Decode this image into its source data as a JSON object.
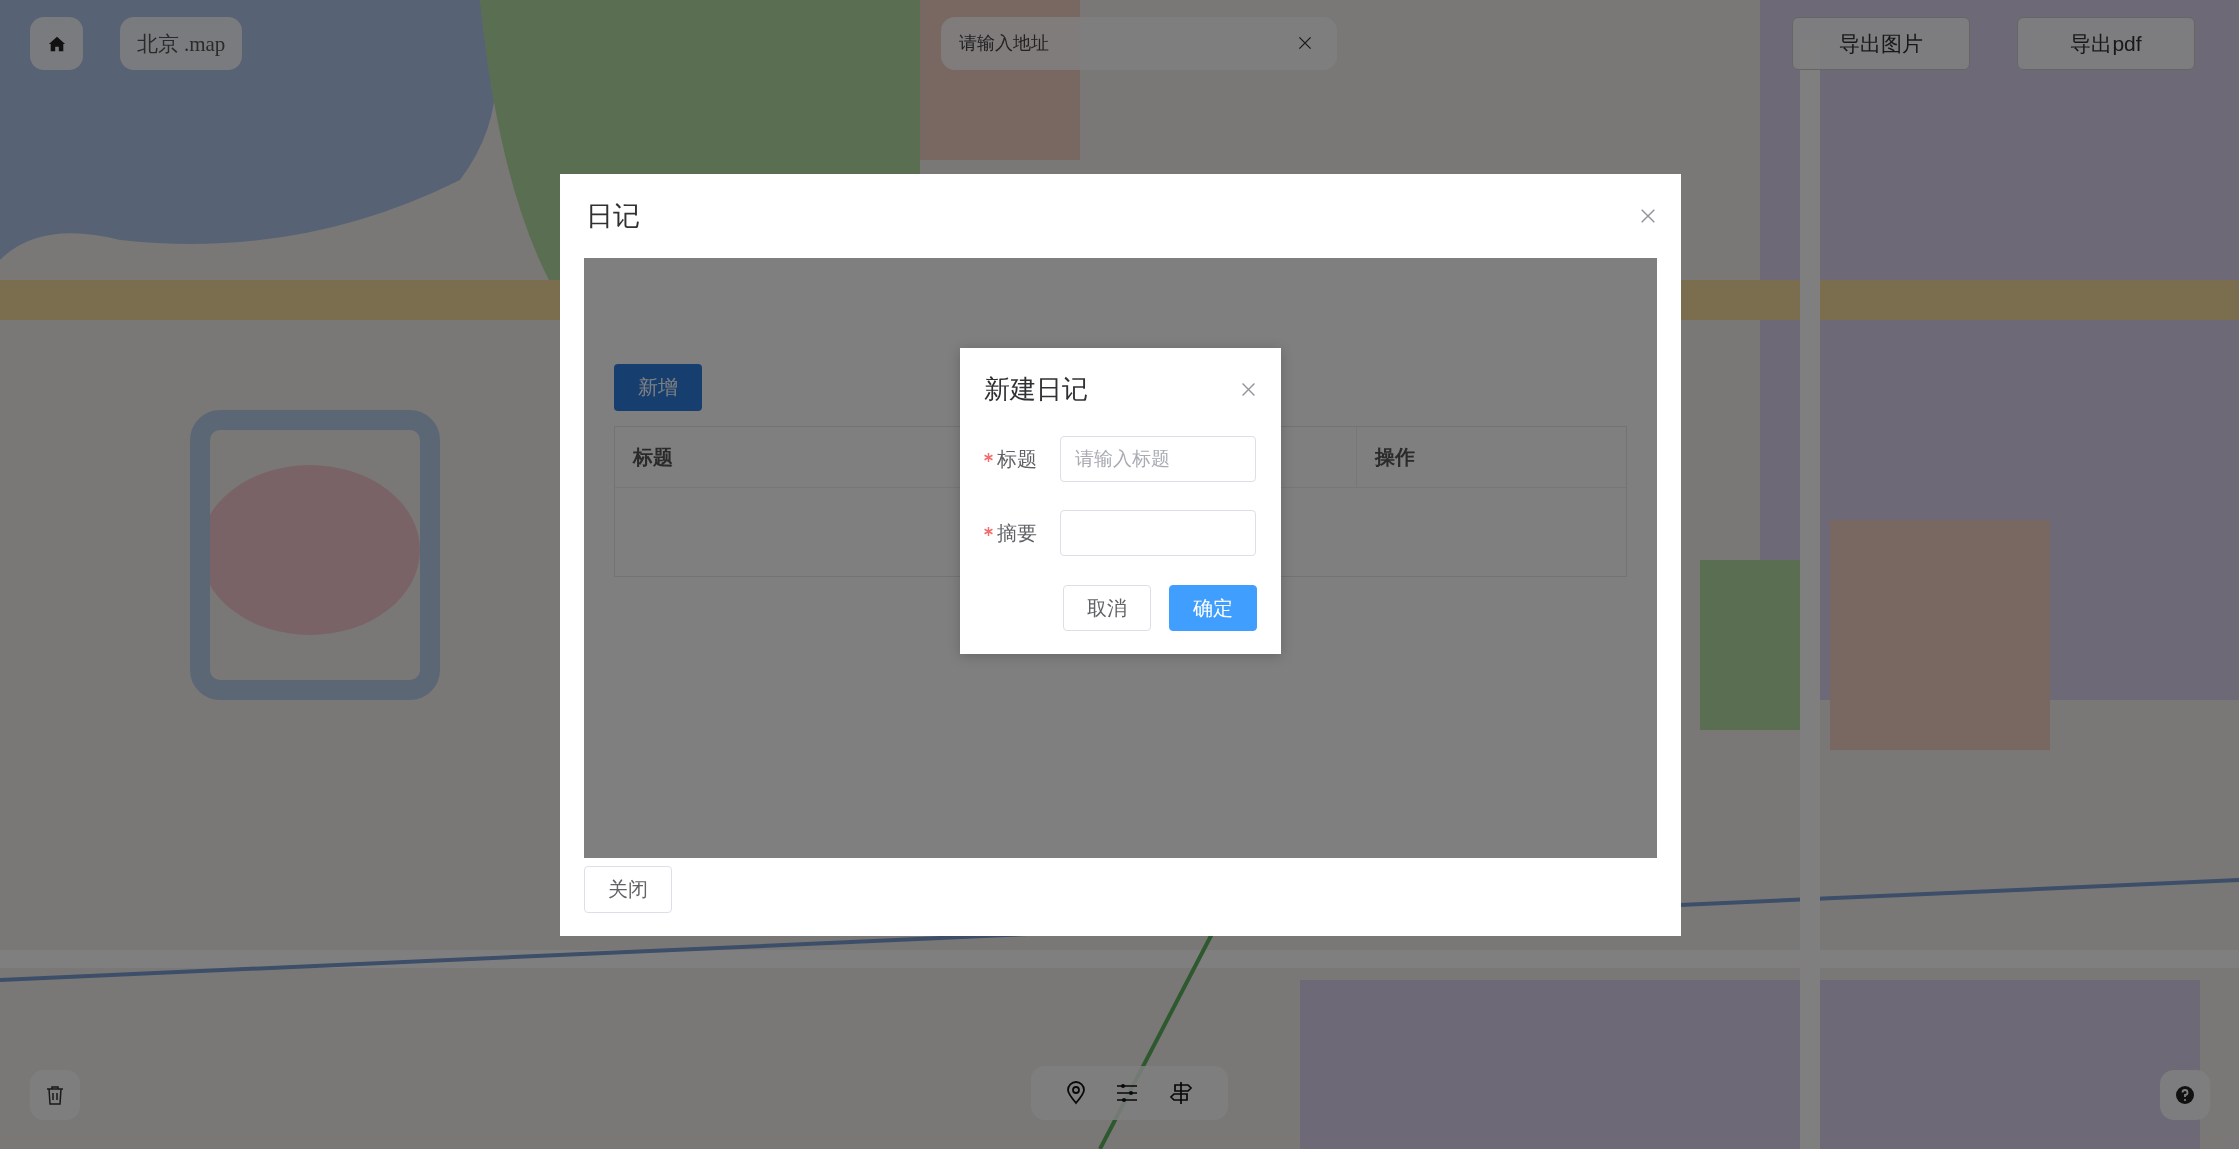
{
  "top_left": {
    "city_label": "北京 .map"
  },
  "search": {
    "placeholder": "请输入地址"
  },
  "export_buttons": [
    "导出图片",
    "导出pdf"
  ],
  "diary_dialog": {
    "title": "日记",
    "add_button": "新增",
    "table": {
      "columns": [
        "标题",
        "操作"
      ]
    },
    "close_button": "关闭"
  },
  "new_diary_dialog": {
    "title": "新建日记",
    "fields": [
      {
        "label": "标题",
        "required": true,
        "placeholder": "请输入标题"
      },
      {
        "label": "摘要",
        "required": true
      }
    ],
    "buttons": [
      {
        "label": "取消",
        "kind": "default"
      },
      {
        "label": "确定",
        "kind": "primary"
      }
    ]
  }
}
